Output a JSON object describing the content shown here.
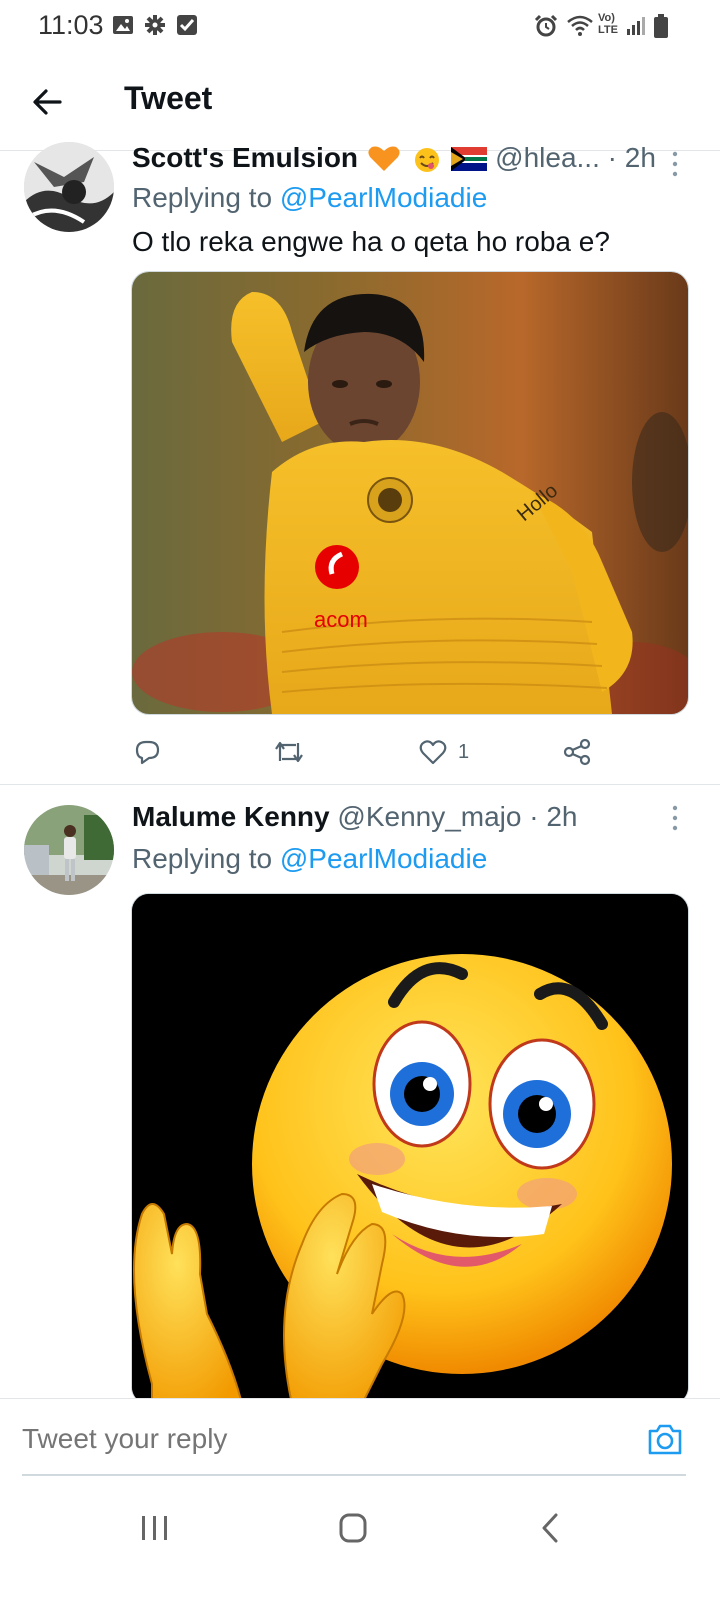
{
  "status_bar": {
    "time": "11:03",
    "net_label_top": "Vo)",
    "net_label_bottom": "LTE",
    "icons": [
      "gallery-icon",
      "settings-icon",
      "checkbox-icon",
      "alarm-icon",
      "wifi-icon",
      "signal-icon",
      "battery-icon"
    ]
  },
  "header": {
    "title": "Tweet"
  },
  "tweets": [
    {
      "name": "Scott's Emulsion",
      "handle": "@hlea...",
      "dot": "·",
      "time": "2h",
      "replying_prefix": "Replying to",
      "replying_to": "@PearlModiadie",
      "text": "O tlo reka engwe ha o qeta ho roba e?",
      "jersey_sponsor": "acom",
      "jersey_sleeve": "Hollo",
      "likes": "1"
    },
    {
      "name": "Malume Kenny",
      "handle": "@Kenny_majo",
      "dot": "·",
      "time": "2h",
      "replying_prefix": "Replying to",
      "replying_to": "@PearlModiadie"
    }
  ],
  "reply_bar": {
    "placeholder": "Tweet your reply"
  },
  "colors": {
    "link": "#1d9bf0",
    "secondary_text": "#536471",
    "jersey": "#f2b51c"
  }
}
